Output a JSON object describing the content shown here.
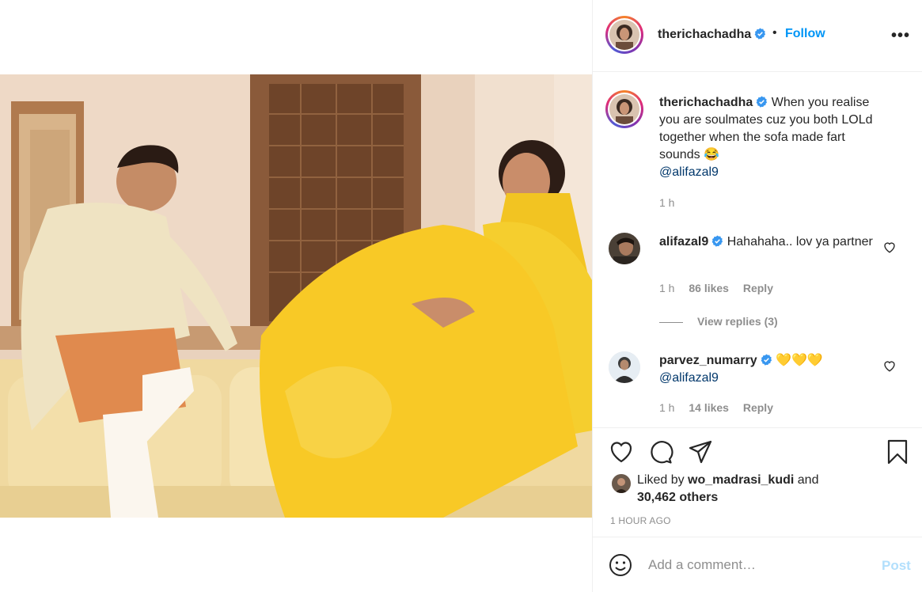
{
  "post": {
    "username": "therichachadha",
    "verified": true,
    "follow_label": "Follow",
    "dot": "•",
    "more_label": "•••"
  },
  "caption": {
    "username": "therichachadha",
    "text": "When you realise you are soulmates cuz you both LOLd together when the sofa made fart sounds 😂",
    "mention": "@alifazal9",
    "time": "1 h"
  },
  "comments": [
    {
      "username": "alifazal9",
      "text": "Hahahaha.. lov ya partner",
      "time": "1 h",
      "likes": "86 likes",
      "reply": "Reply",
      "view_replies": "View replies (3)"
    },
    {
      "username": "parvez_numarry",
      "text": "💛💛💛",
      "mention": "@alifazal9",
      "time": "1 h",
      "likes": "14 likes",
      "reply": "Reply"
    }
  ],
  "likes": {
    "prefix": "Liked by ",
    "user": "wo_madrasi_kudi",
    "and": " and",
    "others": "30,462 others"
  },
  "timestamp": "1 HOUR AGO",
  "add_comment": {
    "placeholder": "Add a comment…",
    "post_label": "Post"
  },
  "icons": {
    "like": "heart-icon",
    "comment": "comment-icon",
    "share": "paper-plane-icon",
    "save": "bookmark-icon",
    "emoji": "smiley-icon",
    "verified": "verified-badge-icon"
  },
  "colors": {
    "accent": "#0095f6",
    "muted": "#8e8e8e",
    "text": "#262626",
    "post_disabled": "#b2dffc"
  }
}
